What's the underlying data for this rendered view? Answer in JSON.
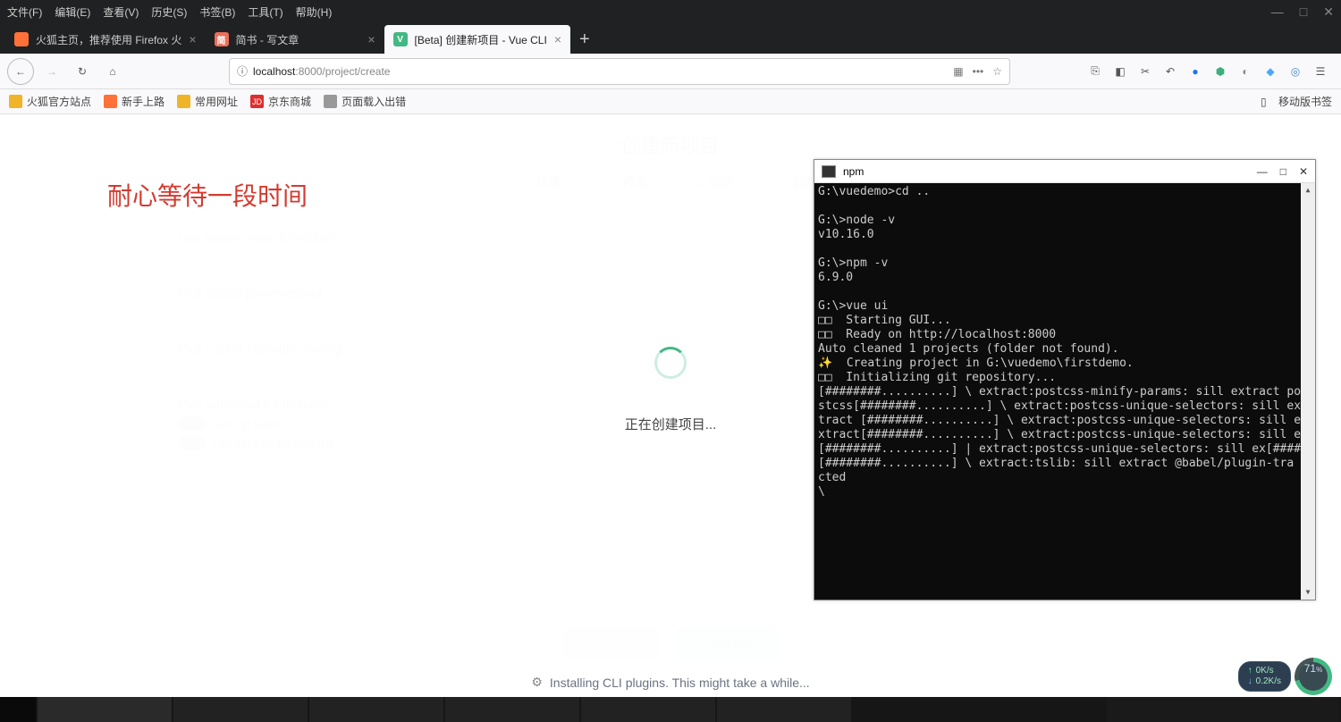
{
  "menubar": [
    "文件(F)",
    "编辑(E)",
    "查看(V)",
    "历史(S)",
    "书签(B)",
    "工具(T)",
    "帮助(H)"
  ],
  "tabs": [
    {
      "label": "火狐主页，推荐使用 Firefox 火",
      "favicon_bg": "#ff7139",
      "favicon_txt": ""
    },
    {
      "label": "简书 - 写文章",
      "favicon_bg": "#ea6f5a",
      "favicon_txt": "简"
    },
    {
      "label": "[Beta] 创建新项目 - Vue CLI",
      "favicon_bg": "#42b983",
      "favicon_txt": "V",
      "active": true
    }
  ],
  "url": {
    "info_icon": "ⓘ",
    "host": "localhost",
    "port": ":8000",
    "path": "/project/create"
  },
  "bookmarks": [
    {
      "icon_bg": "#f0b429",
      "label": "火狐官方站点"
    },
    {
      "icon_bg": "#ff7139",
      "label": "新手上路"
    },
    {
      "icon_bg": "#f0b429",
      "label": "常用网址"
    },
    {
      "icon_bg": "#e02d2d",
      "icon_txt": "JD",
      "label": "京东商城"
    },
    {
      "icon_bg": "#999",
      "label": "页面载入出错"
    }
  ],
  "bookmark_right": "移动版书签",
  "red_note": "耐心等待一段时间",
  "ghost": {
    "title": "创建新项目",
    "steps": [
      "详情",
      "预设",
      "功能",
      "配置"
    ],
    "q1_label": "Use history mode for router?",
    "q2_label": "Pick a CSS pre-processor",
    "q3_label": "Pick a linter / formatter config",
    "q4_label": "Pick additional lint features:",
    "q4_opt1": "Lint on save",
    "q4_opt2": "Lint and fix on commit",
    "btn_back": "← 上一步",
    "btn_create": "✓ 创建项目"
  },
  "creating_text": "正在创建项目...",
  "install_text": "Installing CLI plugins. This might take a while...",
  "console": {
    "title": "npm",
    "lines": "G:\\vuedemo>cd ..\n\nG:\\>node -v\nv10.16.0\n\nG:\\>npm -v\n6.9.0\n\nG:\\>vue ui\n□□  Starting GUI...\n□□  Ready on http://localhost:8000\nAuto cleaned 1 projects (folder not found).\n✨  Creating project in G:\\vuedemo\\firstdemo.\n□□  Initializing git repository...\n[########..........] \\ extract:postcss-minify-params: sill extract po\nstcss[########..........] \\ extract:postcss-unique-selectors: sill ex\ntract [########..........] \\ extract:postcss-unique-selectors: sill e\nxtract[########..........] \\ extract:postcss-unique-selectors: sill e\n[########..........] | extract:postcss-unique-selectors: sill ex[####\n[########..........] \\ extract:tslib: sill extract @babel/plugin-tra\ncted\n\\"
  },
  "speed": {
    "up": "0K/s",
    "down": "0.2K/s",
    "cpu": "71",
    "cpu_suffix": "%"
  }
}
